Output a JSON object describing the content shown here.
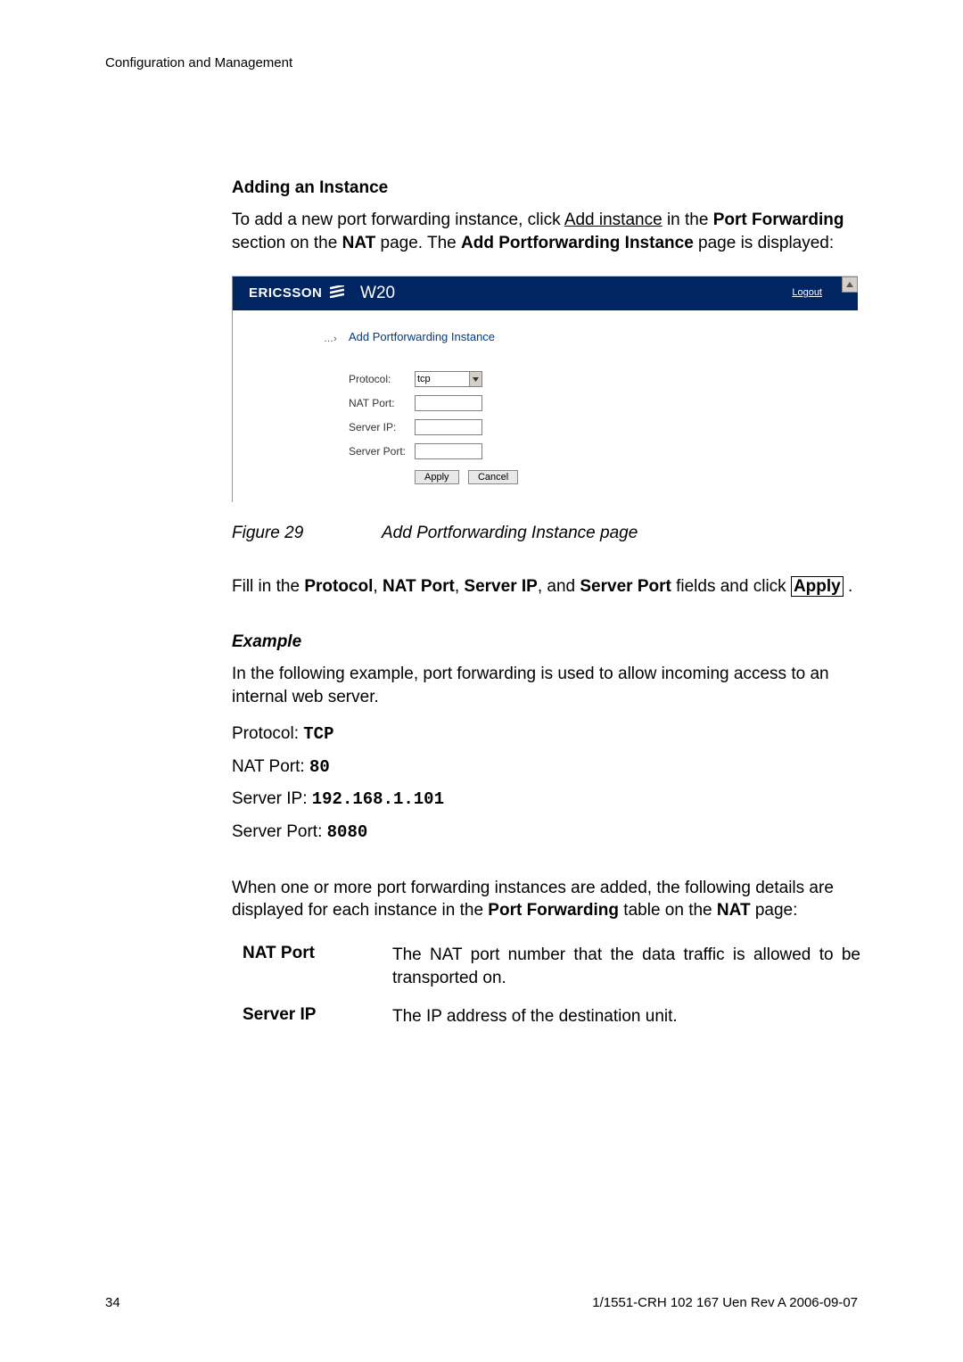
{
  "header": "Configuration and Management",
  "section": {
    "heading": "Adding an Instance",
    "intro_1": "To add a new port forwarding instance, click ",
    "intro_link": "Add instance",
    "intro_2": " in the ",
    "intro_bold1": "Port Forwarding",
    "intro_3": " section on the ",
    "intro_bold2": "NAT",
    "intro_4": " page. The ",
    "intro_bold3": "Add Portforwarding Instance",
    "intro_5": " page is displayed:"
  },
  "screenshot": {
    "brand": "ERICSSON",
    "model": "W20",
    "logout": "Logout",
    "arrow": "…›",
    "form_title": "Add Portforwarding Instance",
    "labels": {
      "protocol": "Protocol:",
      "nat_port": "NAT Port:",
      "server_ip": "Server IP:",
      "server_port": "Server Port:"
    },
    "protocol_value": "tcp",
    "apply": "Apply",
    "cancel": "Cancel"
  },
  "figure": {
    "num": "Figure 29",
    "caption": "Add Portforwarding Instance page"
  },
  "fill_in": {
    "text1": "Fill in the ",
    "b1": "Protocol",
    "sep": ", ",
    "b2": "NAT Port",
    "b3": "Server IP",
    "and": ", and ",
    "b4": "Server Port",
    "text2": " fields and click ",
    "apply": "Apply",
    "period": " ."
  },
  "example": {
    "heading": "Example",
    "desc": "In the following example, port forwarding is used to allow incoming access to an internal web server.",
    "protocol_label": "Protocol: ",
    "protocol_value": "TCP",
    "natport_label": "NAT Port: ",
    "natport_value": "80",
    "serverip_label": "Server IP: ",
    "serverip_value": "192.168.1.101",
    "serverport_label": "Server Port: ",
    "serverport_value": "8080"
  },
  "table_intro": {
    "t1": "When one or more port forwarding instances are added, the following details are displayed for each instance in the ",
    "b1": "Port Forwarding",
    "t2": " table on the ",
    "b2": "NAT",
    "t3": " page:"
  },
  "defs": {
    "nat_port": {
      "term": "NAT Port",
      "desc": "The NAT port number that the data traffic is allowed to be transported on."
    },
    "server_ip": {
      "term": "Server IP",
      "desc": "The IP address of the destination unit."
    }
  },
  "footer": {
    "page": "34",
    "docref": "1/1551-CRH 102 167 Uen Rev A  2006-09-07"
  }
}
